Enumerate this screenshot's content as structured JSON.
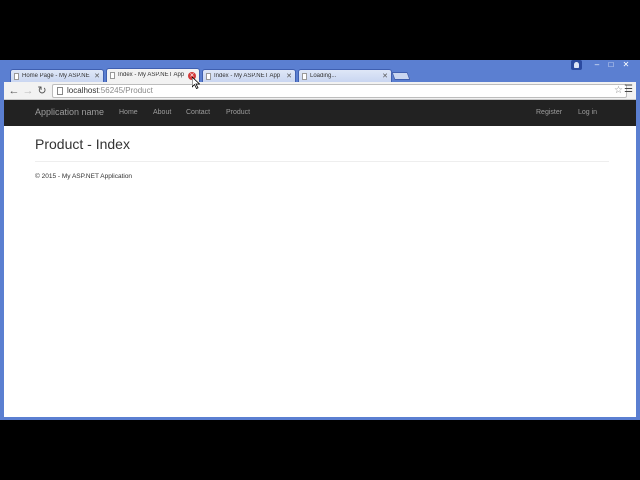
{
  "tabs": [
    {
      "label": "Home Page - My ASP.NE",
      "active": false
    },
    {
      "label": "Index - My ASP.NET App",
      "active": true
    },
    {
      "label": "Index - My ASP.NET App",
      "active": false
    },
    {
      "label": "Loading...",
      "active": false
    }
  ],
  "window": {
    "minimize": "–",
    "maximize": "□",
    "close": "✕"
  },
  "toolbar": {
    "url_host": "localhost",
    "url_rest": ":56245/Product"
  },
  "site": {
    "brand": "Application name",
    "nav": [
      "Home",
      "About",
      "Contact",
      "Product"
    ],
    "nav_right": [
      "Register",
      "Log in"
    ]
  },
  "page": {
    "title": "Product - Index",
    "footer": "© 2015 - My ASP.NET Application"
  },
  "icons": {
    "back": "back-arrow-icon",
    "forward": "forward-arrow-icon",
    "reload": "reload-icon",
    "star": "bookmark-star-icon",
    "menu": "hamburger-menu-icon"
  },
  "colors": {
    "chrome_frame": "#5b7fd1",
    "navbar": "#222222",
    "nav_text": "#9d9d9d"
  }
}
